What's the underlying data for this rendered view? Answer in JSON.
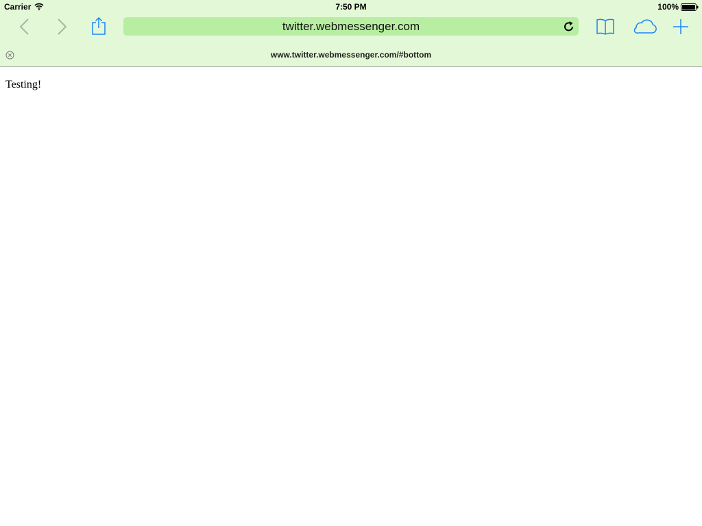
{
  "status_bar": {
    "carrier": "Carrier",
    "time": "7:50 PM",
    "battery_percent": "100%"
  },
  "toolbar": {
    "icons": [
      "chevron-left-icon",
      "chevron-right-icon",
      "share-icon",
      "book-icon",
      "cloud-icon",
      "plus-icon"
    ],
    "accent_color": "#1a82fb",
    "disabled_color": "#a7b7a0"
  },
  "address_bar": {
    "url": "twitter.webmessenger.com",
    "background": "#b8eea2"
  },
  "tab": {
    "title": "www.twitter.webmessenger.com/#bottom"
  },
  "page": {
    "body_text": "Testing!"
  }
}
